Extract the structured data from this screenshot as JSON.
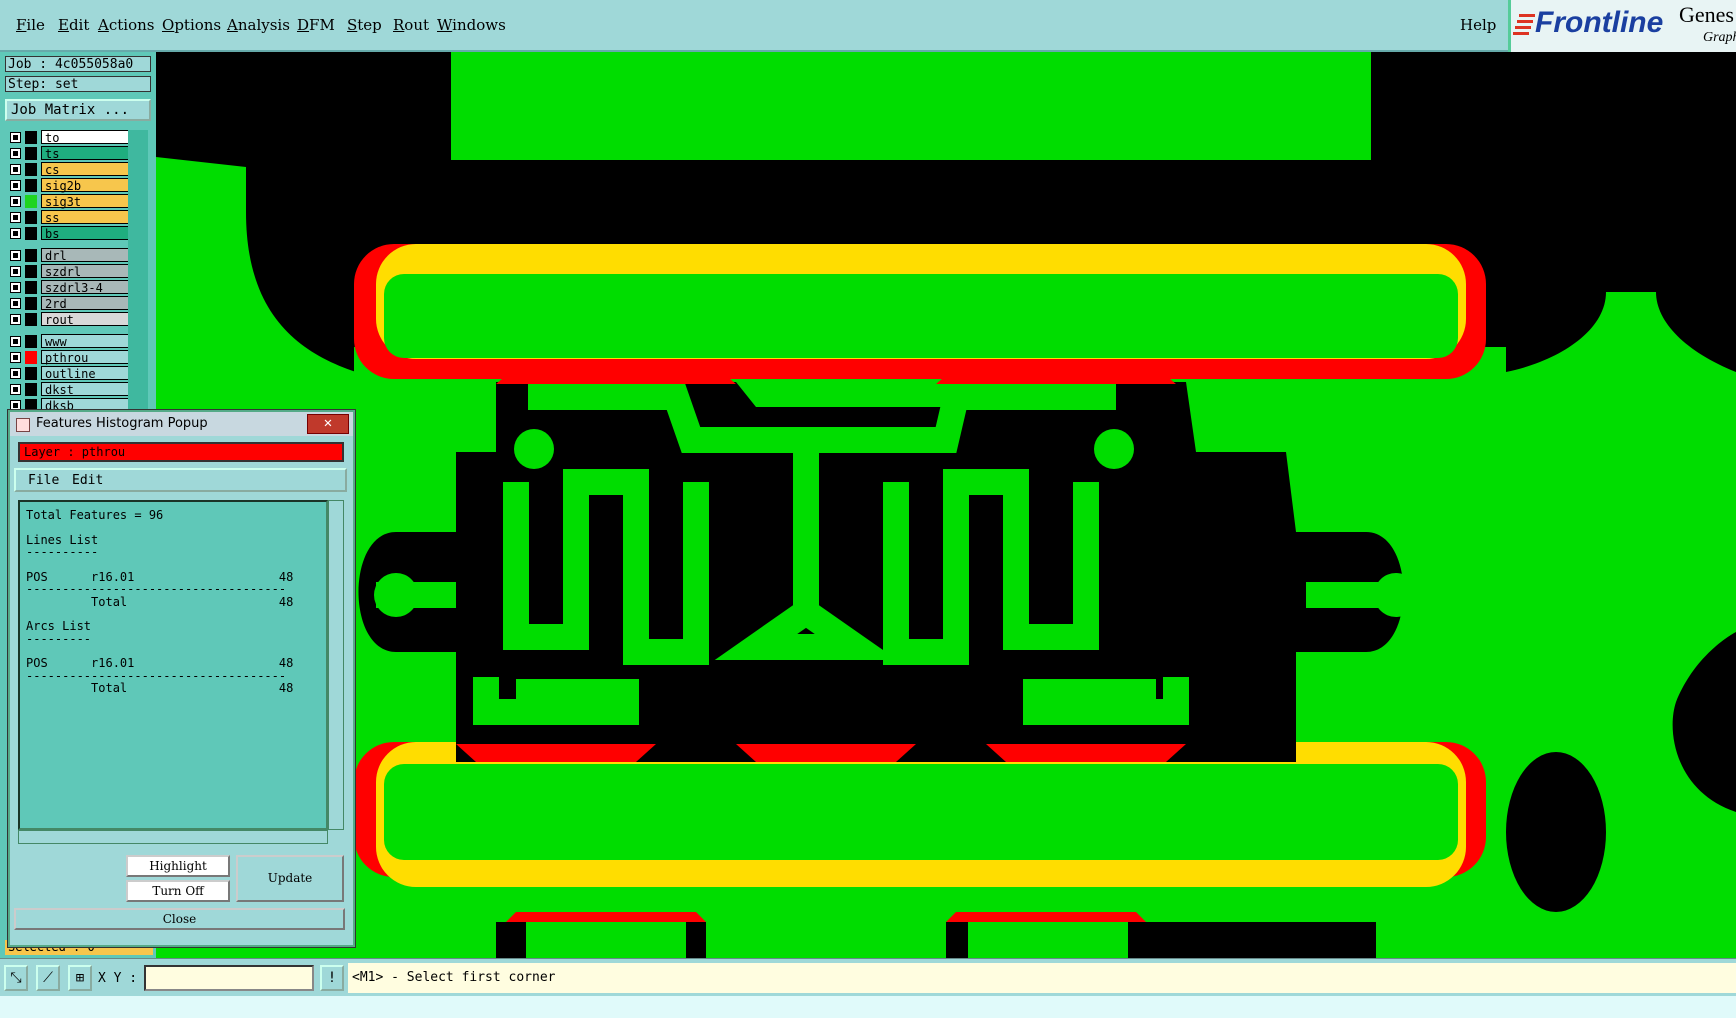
{
  "menu": [
    {
      "label": "File",
      "u": "F",
      "rest": "ile"
    },
    {
      "label": "Edit",
      "u": "E",
      "rest": "dit"
    },
    {
      "label": "Actions",
      "u": "A",
      "rest": "ctions"
    },
    {
      "label": "Options",
      "u": "O",
      "rest": "ptions"
    },
    {
      "label": "Analysis",
      "u": "A",
      "rest": "nalysis"
    },
    {
      "label": "DFM",
      "u": "D",
      "rest": "FM"
    },
    {
      "label": "Step",
      "u": "S",
      "rest": "tep"
    },
    {
      "label": "Rout",
      "u": "R",
      "rest": "out"
    },
    {
      "label": "Windows",
      "u": "W",
      "rest": "indows"
    }
  ],
  "help_label": "Help",
  "brand": {
    "name": "Frontline",
    "product": "Genes",
    "subtitle": "Graph"
  },
  "job_label": "Job : 4c055058a0",
  "step_label": "Step: set",
  "job_matrix_label": "Job Matrix ...",
  "layers": [
    {
      "name": "to",
      "color": "#ffffff",
      "swatch": "#000000"
    },
    {
      "name": "ts",
      "color": "#1fae7f",
      "swatch": "#000000"
    },
    {
      "name": "cs",
      "color": "#f7c64c",
      "swatch": "#000000"
    },
    {
      "name": "sig2b",
      "color": "#f7c64c",
      "swatch": "#000000"
    },
    {
      "name": "sig3t",
      "color": "#f7c64c",
      "swatch": "#1fd41f"
    },
    {
      "name": "ss",
      "color": "#f7c64c",
      "swatch": "#000000"
    },
    {
      "name": "bs",
      "color": "#1fae7f",
      "swatch": "#000000"
    },
    {
      "name": "drl",
      "color": "#a8b8b8",
      "swatch": "#000000"
    },
    {
      "name": "szdrl",
      "color": "#a8b8b8",
      "swatch": "#000000"
    },
    {
      "name": "szdrl3-4",
      "color": "#a8b8b8",
      "swatch": "#000000"
    },
    {
      "name": "2rd",
      "color": "#a8b8b8",
      "swatch": "#000000"
    },
    {
      "name": "rout",
      "color": "#d8d8d8",
      "swatch": "#000000"
    },
    {
      "name": "www",
      "color": "#9fd8d8",
      "swatch": "#000000"
    },
    {
      "name": "pthrou",
      "color": "#9fd8d8",
      "swatch": "#ff0000"
    },
    {
      "name": "outline",
      "color": "#9fd8d8",
      "swatch": "#000000"
    },
    {
      "name": "dkst",
      "color": "#9fd8d8",
      "swatch": "#000000"
    },
    {
      "name": "dksb",
      "color": "#9fd8d8",
      "swatch": "#000000"
    }
  ],
  "selected_label": "Selected : 0",
  "popup": {
    "title": "Features Histogram Popup",
    "close_glyph": "✕",
    "layer_label": "Layer :  pthrou",
    "menu_file": "File",
    "menu_edit": "Edit",
    "lines": [
      "Total Features = 96",
      "",
      "Lines List",
      "----------",
      "",
      "POS      r16.01                    48",
      "------------------------------------",
      "         Total                     48",
      "",
      "Arcs List",
      "---------",
      "",
      "POS      r16.01                    48",
      "------------------------------------",
      "         Total                     48"
    ],
    "highlight_label": "Highlight",
    "turnoff_label": "Turn Off",
    "update_label": "Update",
    "close_label": "Close"
  },
  "xy_label": "X Y :",
  "prompt_text": "<M1> - Select first corner",
  "colors": {
    "copper": "#00dd00",
    "mask": "#ffdd00",
    "pthrou": "#ff0000",
    "bg": "#000000"
  }
}
